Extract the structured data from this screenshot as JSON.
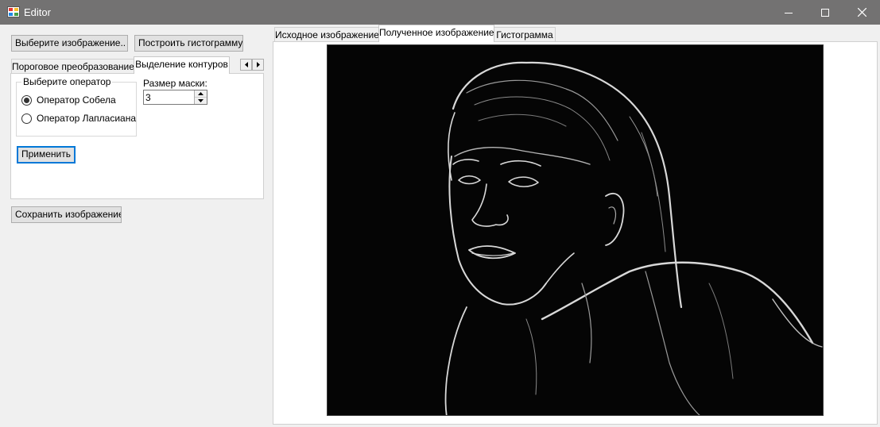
{
  "window": {
    "title": "Editor"
  },
  "toolbar": {
    "choose_image_label": "Выберите изображение..",
    "build_histogram_label": "Построить гистограмму",
    "save_image_label": "Сохранить изображение"
  },
  "left_tabs": {
    "items": [
      {
        "label": "Пороговое преобразование",
        "selected": false
      },
      {
        "label": "Выделение контуров",
        "selected": true
      }
    ]
  },
  "edge_panel": {
    "operator_group_label": "Выберите оператор",
    "operators": [
      {
        "label": "Оператор Собела",
        "checked": true
      },
      {
        "label": "Оператор Лапласиана",
        "checked": false
      }
    ],
    "mask_size_label": "Размер маски:",
    "mask_size_value": "3",
    "apply_label": "Применить"
  },
  "right_tabs": {
    "items": [
      {
        "label": "Исходное изображение",
        "selected": false
      },
      {
        "label": "Полученное изображение",
        "selected": true
      },
      {
        "label": "Гистограмма",
        "selected": false
      }
    ]
  },
  "image": {
    "description_icon": "edge-detected-portrait"
  },
  "colors": {
    "titlebar": "#737272",
    "accent": "#0078d7",
    "image_background": "#050505"
  }
}
